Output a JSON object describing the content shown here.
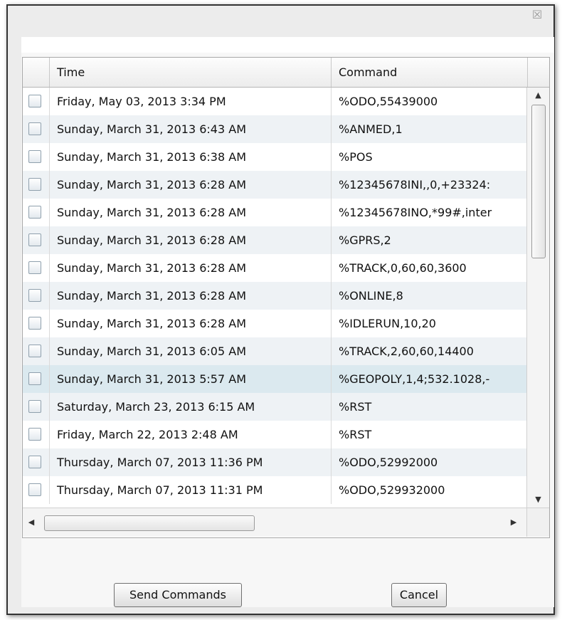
{
  "dialog": {
    "close_icon": "close-icon",
    "close_glyph": "☒"
  },
  "grid": {
    "columns": {
      "time": "Time",
      "command": "Command"
    },
    "rows": [
      {
        "time": "Friday, May 03, 2013 3:34 PM",
        "command": "%ODO,55439000"
      },
      {
        "time": "Sunday, March 31, 2013 6:43 AM",
        "command": "%ANMED,1"
      },
      {
        "time": "Sunday, March 31, 2013 6:38 AM",
        "command": "%POS"
      },
      {
        "time": "Sunday, March 31, 2013 6:28 AM",
        "command": "%12345678INI,,0,+23324:"
      },
      {
        "time": "Sunday, March 31, 2013 6:28 AM",
        "command": "%12345678INO,*99#,inter"
      },
      {
        "time": "Sunday, March 31, 2013 6:28 AM",
        "command": "%GPRS,2"
      },
      {
        "time": "Sunday, March 31, 2013 6:28 AM",
        "command": "%TRACK,0,60,60,3600"
      },
      {
        "time": "Sunday, March 31, 2013 6:28 AM",
        "command": "%ONLINE,8"
      },
      {
        "time": "Sunday, March 31, 2013 6:28 AM",
        "command": "%IDLERUN,10,20"
      },
      {
        "time": "Sunday, March 31, 2013 6:05 AM",
        "command": "%TRACK,2,60,60,14400"
      },
      {
        "time": "Sunday, March 31, 2013 5:57 AM",
        "command": "%GEOPOLY,1,4;532.1028,-"
      },
      {
        "time": "Saturday, March 23, 2013 6:15 AM",
        "command": "%RST"
      },
      {
        "time": "Friday, March 22, 2013 2:48 AM",
        "command": "%RST"
      },
      {
        "time": "Thursday, March 07, 2013 11:36 PM",
        "command": "%ODO,52992000"
      },
      {
        "time": "Thursday, March 07, 2013 11:31 PM",
        "command": "%ODO,529932000"
      }
    ],
    "selected_row": 10,
    "scroll": {
      "up_glyph": "▲",
      "down_glyph": "▼",
      "left_glyph": "◀",
      "right_glyph": "▶"
    }
  },
  "buttons": {
    "send": "Send Commands",
    "cancel": "Cancel"
  },
  "colors": {
    "row_alt": "#eef2f5",
    "row_selected": "#dbe9ef"
  }
}
